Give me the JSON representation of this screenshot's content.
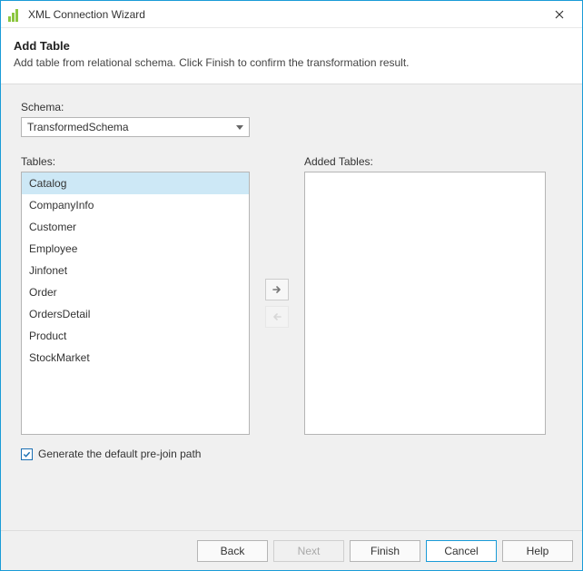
{
  "window": {
    "title": "XML Connection Wizard"
  },
  "header": {
    "title": "Add Table",
    "subtitle": "Add table from relational schema. Click Finish to confirm the transformation result."
  },
  "schema": {
    "label": "Schema:",
    "selected": "TransformedSchema"
  },
  "tables": {
    "label": "Tables:",
    "items": [
      "Catalog",
      "CompanyInfo",
      "Customer",
      "Employee",
      "Jinfonet",
      "Order",
      "OrdersDetail",
      "Product",
      "StockMarket"
    ],
    "selectedIndex": 0
  },
  "addedTables": {
    "label": "Added Tables:",
    "items": []
  },
  "generatePrejoin": {
    "label": "Generate the default pre-join path",
    "checked": true
  },
  "buttons": {
    "back": "Back",
    "next": "Next",
    "finish": "Finish",
    "cancel": "Cancel",
    "help": "Help"
  }
}
